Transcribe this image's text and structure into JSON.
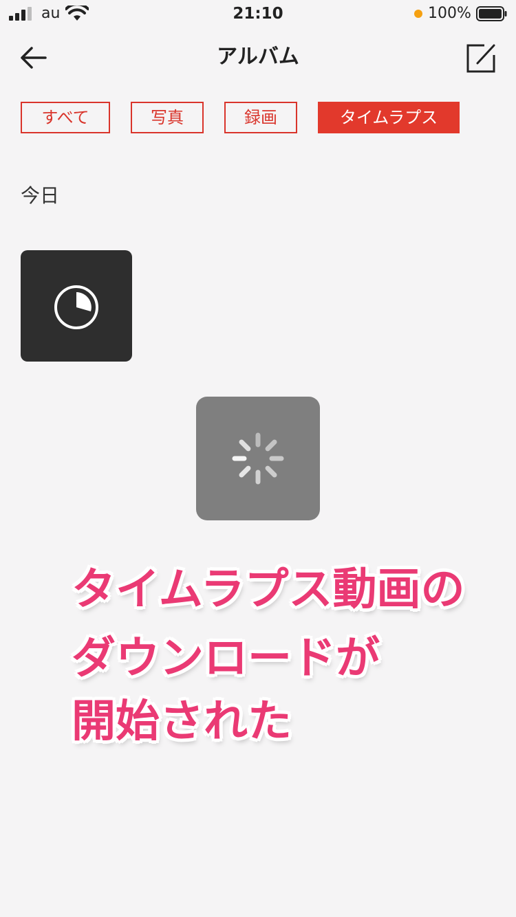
{
  "status_bar": {
    "carrier": "au",
    "time": "21:10",
    "battery_percent": "100%"
  },
  "nav": {
    "title": "アルバム",
    "back_icon": "arrow-left-icon",
    "edit_icon": "edit-icon"
  },
  "tabs": [
    {
      "label": "すべて",
      "active": false
    },
    {
      "label": "写真",
      "active": false
    },
    {
      "label": "録画",
      "active": false
    },
    {
      "label": "タイムラプス",
      "active": true
    }
  ],
  "section": {
    "date_label": "今日"
  },
  "thumbnail": {
    "icon": "timelapse-clock-icon"
  },
  "loader": {
    "icon": "spinner-icon"
  },
  "caption": {
    "line1": "タイムラプス動画の",
    "line2": "ダウンロードが",
    "line3": "開始された"
  },
  "colors": {
    "accent": "#e2392c",
    "caption": "#ea3a74",
    "background": "#f5f4f5"
  }
}
